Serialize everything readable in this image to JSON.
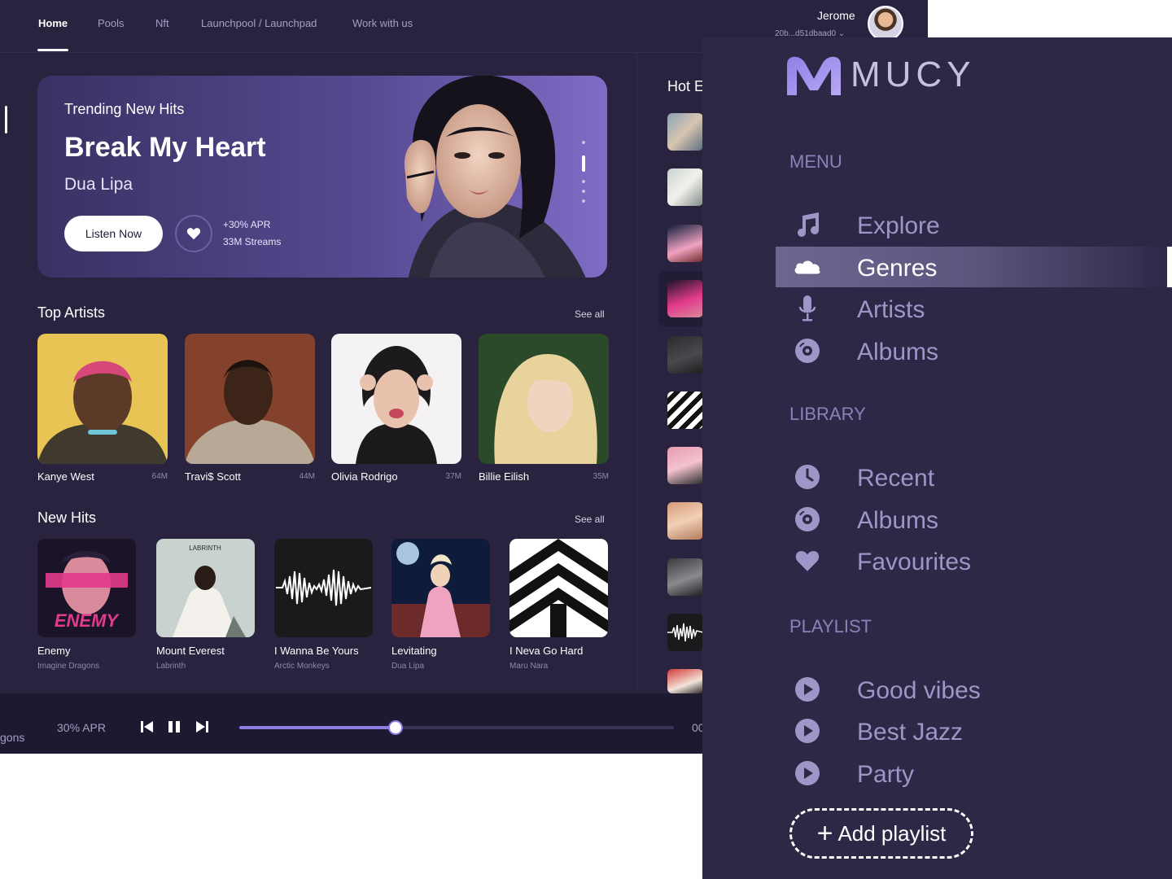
{
  "nav": {
    "items": [
      "Home",
      "Pools",
      "Nft",
      "Launchpool / Launchpad",
      "Work with us"
    ],
    "active": "Home"
  },
  "user": {
    "name": "Jerome",
    "wallet": "20b...d51dbaad0"
  },
  "hero": {
    "kicker": "Trending New Hits",
    "title": "Break My Heart",
    "artist": "Dua Lipa",
    "listen_label": "Listen Now",
    "apr": "+30% APR",
    "streams": "33M Streams"
  },
  "top_artists": {
    "title": "Top Artists",
    "see_all": "See all",
    "items": [
      {
        "name": "Kanye West",
        "count": "64M"
      },
      {
        "name": "Travi$ Scott",
        "count": "44M"
      },
      {
        "name": "Olivia Rodrigo",
        "count": "37M"
      },
      {
        "name": "Billie Eilish",
        "count": "35M"
      }
    ]
  },
  "new_hits": {
    "title": "New Hits",
    "see_all": "See all",
    "items": [
      {
        "title": "Enemy",
        "artist": "Imagine Dragons",
        "cover_text": "ENEMY"
      },
      {
        "title": "Mount Everest",
        "artist": "Labrinth",
        "cover_text": "LABRINTH"
      },
      {
        "title": "I Wanna Be Yours",
        "artist": "Arctic Monkeys"
      },
      {
        "title": "Levitating",
        "artist": "Dua Lipa"
      },
      {
        "title": "I Neva Go Hard",
        "artist": "Maru Nara"
      }
    ]
  },
  "hot": {
    "title": "Hot E"
  },
  "player": {
    "artist_fragment": "gons",
    "apr": "30% APR",
    "progress": 0.36,
    "time_fragment": "00"
  },
  "sidebar": {
    "logo_text": "MUCY",
    "menu_heading": "MENU",
    "menu": [
      {
        "label": "Explore",
        "icon": "music-note-icon"
      },
      {
        "label": "Genres",
        "icon": "cloud-icon",
        "active": true
      },
      {
        "label": "Artists",
        "icon": "microphone-icon"
      },
      {
        "label": "Albums",
        "icon": "disc-icon"
      }
    ],
    "library_heading": "LIBRARY",
    "library": [
      {
        "label": "Recent",
        "icon": "clock-icon"
      },
      {
        "label": "Albums",
        "icon": "disc-icon"
      },
      {
        "label": "Favourites",
        "icon": "heart-icon"
      }
    ],
    "playlist_heading": "PLAYLIST",
    "playlists": [
      {
        "label": "Good vibes",
        "icon": "play-icon"
      },
      {
        "label": "Best Jazz",
        "icon": "play-icon"
      },
      {
        "label": "Party",
        "icon": "play-icon"
      }
    ],
    "add_playlist": "Add playlist"
  },
  "colors": {
    "app_bg": "#29233f",
    "sidebar_bg": "#2e2847",
    "accent": "#8d7de0",
    "sidebar_text": "#9d96c7"
  }
}
